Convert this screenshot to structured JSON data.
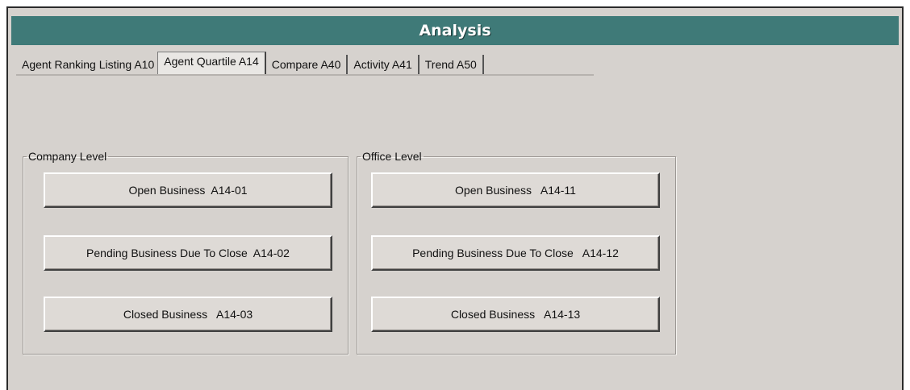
{
  "window": {
    "title": "Analysis"
  },
  "tabs": [
    {
      "label": "Agent Ranking Listing A10",
      "active": false
    },
    {
      "label": "Agent Quartile A14",
      "active": true
    },
    {
      "label": "Compare A40",
      "active": false
    },
    {
      "label": "Activity A41",
      "active": false
    },
    {
      "label": "Trend A50",
      "active": false
    }
  ],
  "company_level": {
    "label": "Company Level",
    "buttons": [
      {
        "label": "Open Business  A14-01"
      },
      {
        "label": "Pending Business Due To Close  A14-02"
      },
      {
        "label": "Closed Business   A14-03"
      }
    ]
  },
  "office_level": {
    "label": "Office Level",
    "buttons": [
      {
        "label": "Open Business   A14-11"
      },
      {
        "label": "Pending Business Due To Close   A14-12"
      },
      {
        "label": "Closed Business   A14-13"
      }
    ]
  },
  "colors": {
    "titlebar": "#3f7a78",
    "panel": "#d6d2ce"
  }
}
